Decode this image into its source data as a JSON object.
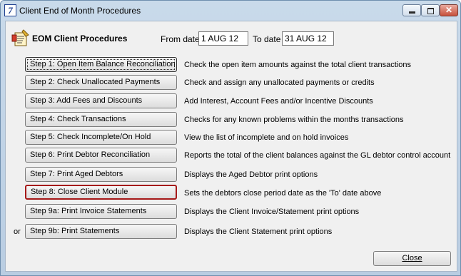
{
  "window": {
    "icon_glyph": "7",
    "title": "Client End of Month Procedures",
    "close_glyph": "✕"
  },
  "header": {
    "heading": "EOM Client Procedures",
    "from_label": "From date",
    "from_value": "1 AUG 12",
    "to_label": "To date",
    "to_value": "31 AUG 12"
  },
  "steps": [
    {
      "label": "Step 1: Open Item Balance Reconciliation",
      "description": "Check the open item amounts against the total client transactions"
    },
    {
      "label": "Step 2: Check Unallocated Payments",
      "description": "Check and assign any unallocated payments or credits"
    },
    {
      "label": "Step 3: Add Fees and Discounts",
      "description": "Add Interest, Account Fees and/or Incentive Discounts"
    },
    {
      "label": "Step 4: Check Transactions",
      "description": "Checks for any known problems within the months transactions"
    },
    {
      "label": "Step 5:  Check Incomplete/On Hold",
      "description": "View the list of incomplete and on hold invoices"
    },
    {
      "label": "Step 6: Print Debtor Reconciliation",
      "description": "Reports the total of the client balances against the GL debtor control account"
    },
    {
      "label": "Step 7: Print Aged Debtors",
      "description": "Displays the Aged Debtor print options"
    },
    {
      "label": "Step 8: Close Client Module",
      "description": "Sets the debtors close period date as the 'To' date above"
    },
    {
      "label": "Step 9a: Print Invoice Statements",
      "description": "Displays the Client Invoice/Statement print options"
    },
    {
      "label": "Step 9b: Print Statements",
      "description": "Displays the Client Statement print options"
    }
  ],
  "or_label": "or",
  "close_label": "Close",
  "highlight_color": "#a51818"
}
